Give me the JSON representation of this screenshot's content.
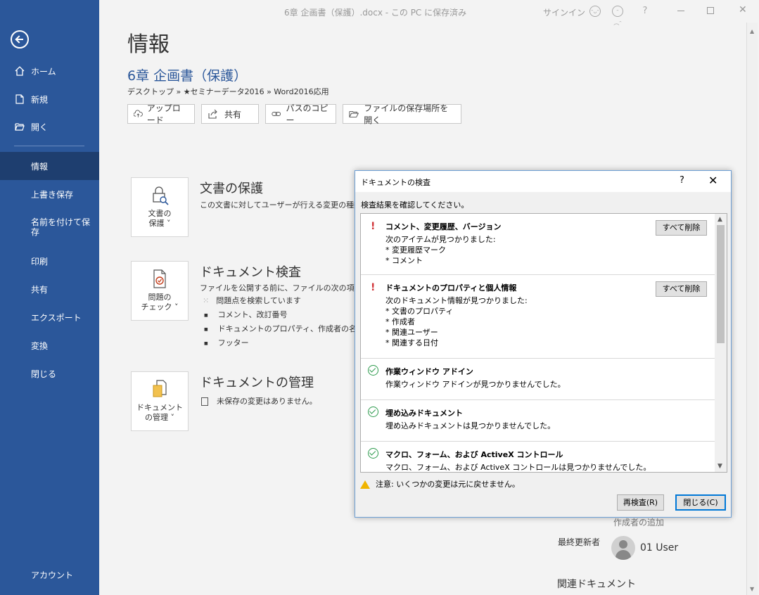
{
  "window": {
    "doc_title": "6章 企画書（保護）.docx - この PC に保存済み",
    "signin": "サインイン",
    "help": "?"
  },
  "sidebar": {
    "items": [
      {
        "label": "ホーム",
        "icon": "home-icon"
      },
      {
        "label": "新規",
        "icon": "new-document-icon"
      },
      {
        "label": "開く",
        "icon": "folder-open-icon"
      },
      {
        "label": "情報"
      },
      {
        "label": "上書き保存"
      },
      {
        "label": "名前を付けて保存"
      },
      {
        "label": "印刷"
      },
      {
        "label": "共有"
      },
      {
        "label": "エクスポート"
      },
      {
        "label": "変換"
      },
      {
        "label": "閉じる"
      },
      {
        "label": "アカウント"
      }
    ],
    "active_item": "情報"
  },
  "main": {
    "page_title": "情報",
    "doc_name": "6章 企画書（保護）",
    "breadcrumb": "デスクトップ » ★セミナーデータ2016 » Word2016応用",
    "actions": [
      {
        "label": "アップロード",
        "icon": "upload-icon"
      },
      {
        "label": "共有",
        "icon": "share-icon"
      },
      {
        "label": "パスのコピー",
        "icon": "link-icon"
      },
      {
        "label": "ファイルの保存場所を開く",
        "icon": "folder-icon"
      }
    ],
    "protect": {
      "tile_line1": "文書の",
      "tile_line2": "保護 ˅",
      "title": "文書の保護",
      "desc": "この文書に対してユーザーが行える変更の種類"
    },
    "inspect": {
      "tile_line1": "問題の",
      "tile_line2": "チェック ˅",
      "title": "ドキュメント検査",
      "desc": "ファイルを公開する前に、ファイルの次の項目を確",
      "searching": "問題点を検索しています",
      "bullets": [
        "コメント、改訂番号",
        "ドキュメントのプロパティ、作成者の名前、",
        "フッター"
      ]
    },
    "manage": {
      "tile_line1": "ドキュメント",
      "tile_line2": "の管理 ˅",
      "title": "ドキュメントの管理",
      "desc": "未保存の変更はありません。"
    },
    "author_add": "作成者の追加",
    "last_modified_label": "最終更新者",
    "user_name": "01 User",
    "related_docs": "関連ドキュメント"
  },
  "dialog": {
    "title": "ドキュメントの検査",
    "help": "?",
    "instruction": "検査結果を確認してください。",
    "results": [
      {
        "status": "warning",
        "title": "コメント、変更履歴、バージョン",
        "text": "次のアイテムが見つかりました:\n* 変更履歴マーク\n* コメント",
        "button": "すべて削除"
      },
      {
        "status": "warning",
        "title": "ドキュメントのプロパティと個人情報",
        "text": "次のドキュメント情報が見つかりました:\n* 文書のプロパティ\n* 作成者\n* 関連ユーザー\n* 関連する日付",
        "button": "すべて削除"
      },
      {
        "status": "ok",
        "title": "作業ウィンドウ アドイン",
        "text": "作業ウィンドウ アドインが見つかりませんでした。"
      },
      {
        "status": "ok",
        "title": "埋め込みドキュメント",
        "text": "埋め込みドキュメントは見つかりませんでした。"
      },
      {
        "status": "ok",
        "title": "マクロ、フォーム、および ActiveX コントロール",
        "text": "マクロ、フォーム、および ActiveX コントロールは見つかりませんでした。"
      }
    ],
    "warning": "注意: いくつかの変更は元に戻せません。",
    "reinspect_button": "再検査(R)",
    "close_button": "閉じる(C)"
  }
}
